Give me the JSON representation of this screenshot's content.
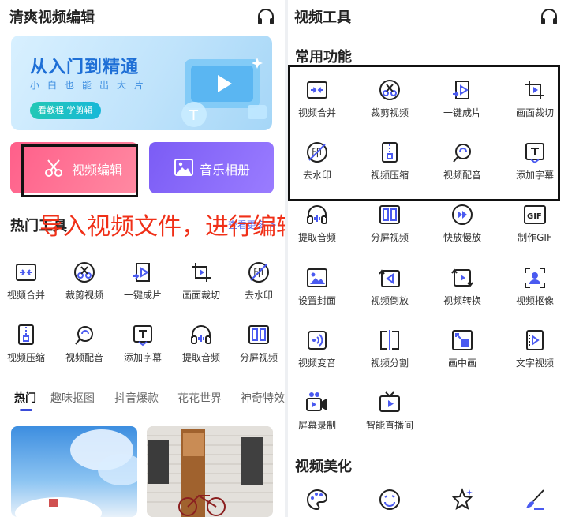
{
  "left": {
    "title": "清爽视频编辑",
    "banner": {
      "title": "从入门到精通",
      "subtitle": "小白也能出大片",
      "button": "看教程 学剪辑"
    },
    "cards": {
      "edit": "视频编辑",
      "music": "音乐相册"
    },
    "hot_tools": {
      "title": "热门工具",
      "more": "查看更多 >",
      "items": [
        {
          "label": "视频合并",
          "icon": "merge-icon"
        },
        {
          "label": "裁剪视频",
          "icon": "scissors-icon"
        },
        {
          "label": "一键成片",
          "icon": "one-click-icon"
        },
        {
          "label": "画面裁切",
          "icon": "crop-icon"
        },
        {
          "label": "去水印",
          "icon": "watermark-icon"
        },
        {
          "label": "视频压缩",
          "icon": "compress-icon"
        },
        {
          "label": "视频配音",
          "icon": "dub-icon"
        },
        {
          "label": "添加字幕",
          "icon": "subtitle-icon"
        },
        {
          "label": "提取音频",
          "icon": "headphone-icon"
        },
        {
          "label": "分屏视频",
          "icon": "split-screen-icon"
        }
      ]
    },
    "tabs": [
      "热门",
      "趣味抠图",
      "抖音爆款",
      "花花世界",
      "神奇特效"
    ],
    "overlay": "导入视频文件，进行编辑"
  },
  "right": {
    "title": "视频工具",
    "common_title": "常用功能",
    "tools": [
      {
        "label": "视频合并",
        "icon": "merge-icon"
      },
      {
        "label": "裁剪视频",
        "icon": "scissors-icon"
      },
      {
        "label": "一键成片",
        "icon": "one-click-icon"
      },
      {
        "label": "画面裁切",
        "icon": "crop-icon"
      },
      {
        "label": "去水印",
        "icon": "watermark-icon"
      },
      {
        "label": "视频压缩",
        "icon": "compress-icon"
      },
      {
        "label": "视频配音",
        "icon": "dub-icon"
      },
      {
        "label": "添加字幕",
        "icon": "subtitle-icon"
      },
      {
        "label": "提取音频",
        "icon": "headphone-icon"
      },
      {
        "label": "分屏视频",
        "icon": "split-screen-icon"
      },
      {
        "label": "快放慢放",
        "icon": "speed-icon"
      },
      {
        "label": "制作GIF",
        "icon": "gif-icon"
      },
      {
        "label": "设置封面",
        "icon": "cover-icon"
      },
      {
        "label": "视频倒放",
        "icon": "reverse-icon"
      },
      {
        "label": "视频转换",
        "icon": "convert-icon"
      },
      {
        "label": "视频抠像",
        "icon": "portrait-icon"
      },
      {
        "label": "视频变音",
        "icon": "voice-change-icon"
      },
      {
        "label": "视频分割",
        "icon": "split-icon"
      },
      {
        "label": "画中画",
        "icon": "pip-icon"
      },
      {
        "label": "文字视频",
        "icon": "text-video-icon"
      },
      {
        "label": "屏幕录制",
        "icon": "record-icon"
      },
      {
        "label": "智能直播间",
        "icon": "tv-icon"
      }
    ],
    "beauty_title": "视频美化",
    "beauty_icons": [
      "palette-icon",
      "face-icon",
      "sparkle-star-icon",
      "brush-icon"
    ]
  },
  "colors": {
    "accent": "#3a4bd8",
    "annotation": "#f03018"
  }
}
